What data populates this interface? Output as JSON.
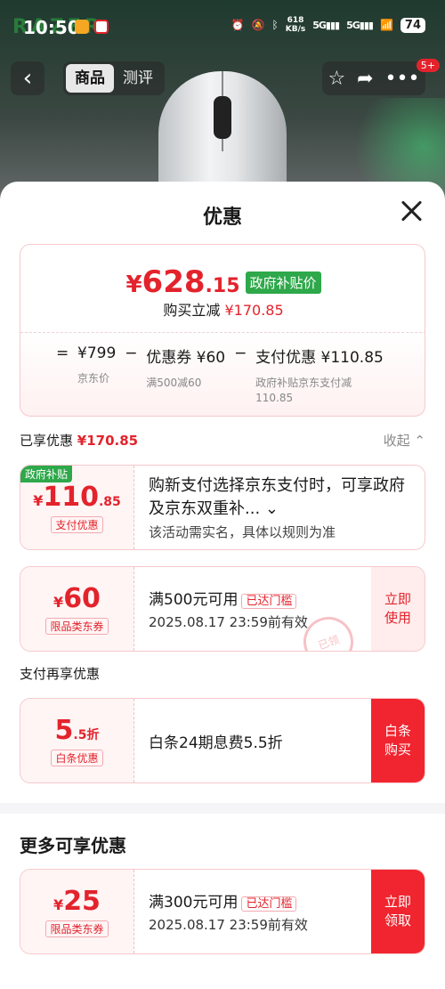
{
  "status": {
    "time": "10:50",
    "net_speed": "618",
    "net_unit": "KB/s",
    "sig1": "5G",
    "sig2": "5G",
    "battery": "74"
  },
  "nav": {
    "tabs": [
      "商品",
      "测评"
    ],
    "badge": "5+"
  },
  "sheet": {
    "title": "优惠"
  },
  "price": {
    "yen": "¥",
    "int": "628",
    "dec": ".15",
    "tag": "政府补贴价",
    "sub_label": "购买立减",
    "sub_value": "¥170.85",
    "calc": [
      {
        "op": "=",
        "value": "¥799",
        "desc": "京东价"
      },
      {
        "op": "−",
        "value": "优惠券 ¥60",
        "desc": "满500减60"
      },
      {
        "op": "−",
        "value": "支付优惠 ¥110.85",
        "desc": "政府补贴京东支付减\n110.85"
      }
    ]
  },
  "enjoy": {
    "label": "已享优惠",
    "value": "¥170.85",
    "collapse": "收起 ⌃"
  },
  "coupons": [
    {
      "tag": "政府补贴",
      "y": "¥",
      "n": "110",
      "d": ".85",
      "lbl": "支付优惠",
      "line1": "购新支付选择京东支付时，可享政府及京东双重补... ⌄",
      "line2": "该活动需实名，具体以规则为准"
    },
    {
      "y": "¥",
      "n": "60",
      "lbl": "限品类东券",
      "line1": "满500元可用",
      "reached": "已达门槛",
      "line2": "2025.08.17 23:59前有效",
      "action": "立即\n使用",
      "stamp": "已领"
    },
    {
      "n": "5",
      "d": ".5折",
      "lbl": "白条优惠",
      "line1": "白条24期息费5.5折",
      "action": "白条\n购买"
    },
    {
      "y": "¥",
      "n": "25",
      "lbl": "限品类东券",
      "line1": "满300元可用",
      "reached": "已达门槛",
      "line2": "2025.08.17 23:59前有效",
      "action": "立即\n领取"
    }
  ],
  "sections": {
    "pay_more": "支付再享优惠",
    "more": "更多可享优惠"
  },
  "colors": {
    "accent": "#e3232c",
    "green": "#2ea84a"
  }
}
